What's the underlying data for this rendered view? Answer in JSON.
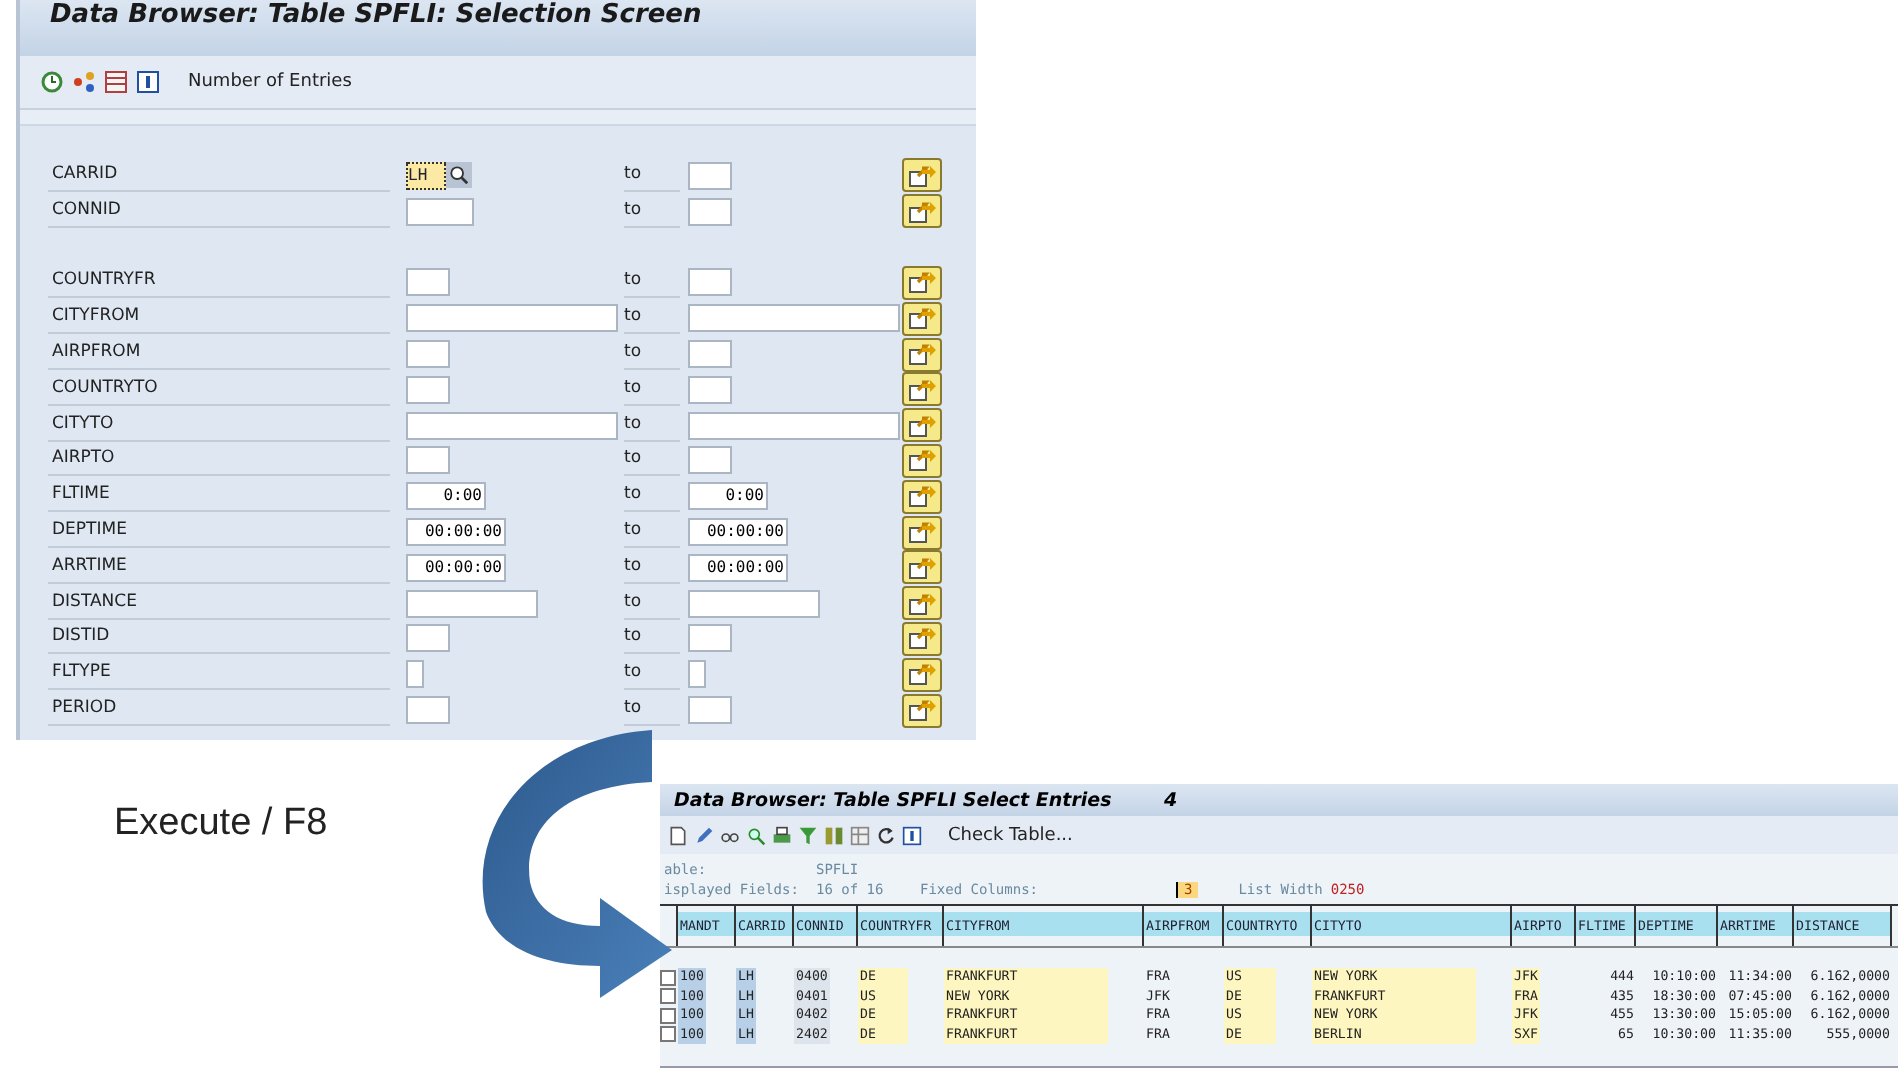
{
  "selection_screen": {
    "title": "Data Browser: Table SPFLI: Selection Screen",
    "toolbar": {
      "label": "Number of Entries"
    },
    "field_groups": [
      [
        {
          "name": "CARRID",
          "kind": "short",
          "low": "LH",
          "focused": true,
          "to": "to"
        },
        {
          "name": "CONNID",
          "kind": "medium4",
          "focused": false,
          "to": "to"
        }
      ],
      [
        {
          "name": "COUNTRYFR",
          "kind": "short",
          "focused": false,
          "to": "to"
        },
        {
          "name": "CITYFROM",
          "kind": "wide",
          "focused": false,
          "to": "to"
        },
        {
          "name": "AIRPFROM",
          "kind": "short",
          "focused": false,
          "to": "to"
        },
        {
          "name": "COUNTRYTO",
          "kind": "short",
          "focused": false,
          "to": "to"
        },
        {
          "name": "CITYTO",
          "kind": "wide",
          "focused": false,
          "to": "to"
        },
        {
          "name": "AIRPTO",
          "kind": "short",
          "focused": false,
          "to": "to"
        },
        {
          "name": "FLTIME",
          "kind": "time",
          "low": "0:00",
          "high": "0:00",
          "focused": false,
          "to": "to"
        },
        {
          "name": "DEPTIME",
          "kind": "clock",
          "low": "00:00:00",
          "high": "00:00:00",
          "focused": false,
          "to": "to"
        },
        {
          "name": "ARRTIME",
          "kind": "clock",
          "low": "00:00:00",
          "high": "00:00:00",
          "focused": false,
          "to": "to"
        },
        {
          "name": "DISTANCE",
          "kind": "medium",
          "focused": false,
          "to": "to"
        },
        {
          "name": "DISTID",
          "kind": "short",
          "focused": false,
          "to": "to"
        },
        {
          "name": "FLTYPE",
          "kind": "tiny",
          "focused": false,
          "to": "to"
        },
        {
          "name": "PERIOD",
          "kind": "short",
          "focused": false,
          "to": "to"
        }
      ]
    ]
  },
  "caption": "Execute / F8",
  "result_list": {
    "title": "Data Browser: Table SPFLI Select Entries",
    "count": "4",
    "toolbar": {
      "label": "Check Table..."
    },
    "info": {
      "table_label": "able:",
      "table_value": "SPFLI",
      "fields_label": "isplayed Fields:",
      "fields_value": "16 of 16",
      "fixed_label": "Fixed Columns:",
      "fixed_value": "3",
      "width_label": "List Width",
      "width_value": "0250"
    },
    "columns": [
      {
        "label": "MANDT",
        "kind": "key"
      },
      {
        "label": "CARRID",
        "kind": "key"
      },
      {
        "label": "CONNID",
        "kind": "id"
      },
      {
        "label": "COUNTRYFR",
        "kind": "text"
      },
      {
        "label": "CITYFROM",
        "kind": "text"
      },
      {
        "label": "AIRPFROM",
        "kind": "plain"
      },
      {
        "label": "COUNTRYTO",
        "kind": "text"
      },
      {
        "label": "CITYTO",
        "kind": "text"
      },
      {
        "label": "AIRPTO",
        "kind": "text"
      },
      {
        "label": "FLTIME",
        "kind": "number"
      },
      {
        "label": "DEPTIME",
        "kind": "number"
      },
      {
        "label": "ARRTIME",
        "kind": "number"
      },
      {
        "label": "DISTANCE",
        "kind": "number"
      }
    ],
    "rows": [
      {
        "selected": false,
        "cells": [
          "100",
          "LH",
          "0400",
          "DE",
          "FRANKFURT",
          "FRA",
          "US",
          "NEW YORK",
          "JFK",
          "444",
          "10:10:00",
          "11:34:00",
          "6.162,0000"
        ]
      },
      {
        "selected": false,
        "cells": [
          "100",
          "LH",
          "0401",
          "US",
          "NEW YORK",
          "JFK",
          "DE",
          "FRANKFURT",
          "FRA",
          "435",
          "18:30:00",
          "07:45:00",
          "6.162,0000"
        ]
      },
      {
        "selected": false,
        "cells": [
          "100",
          "LH",
          "0402",
          "DE",
          "FRANKFURT",
          "FRA",
          "US",
          "NEW YORK",
          "JFK",
          "455",
          "13:30:00",
          "15:05:00",
          "6.162,0000"
        ]
      },
      {
        "selected": false,
        "cells": [
          "100",
          "LH",
          "2402",
          "DE",
          "FRANKFURT",
          "FRA",
          "DE",
          "BERLIN",
          "SXF",
          "65",
          "10:30:00",
          "11:35:00",
          "555,0000"
        ]
      }
    ]
  }
}
